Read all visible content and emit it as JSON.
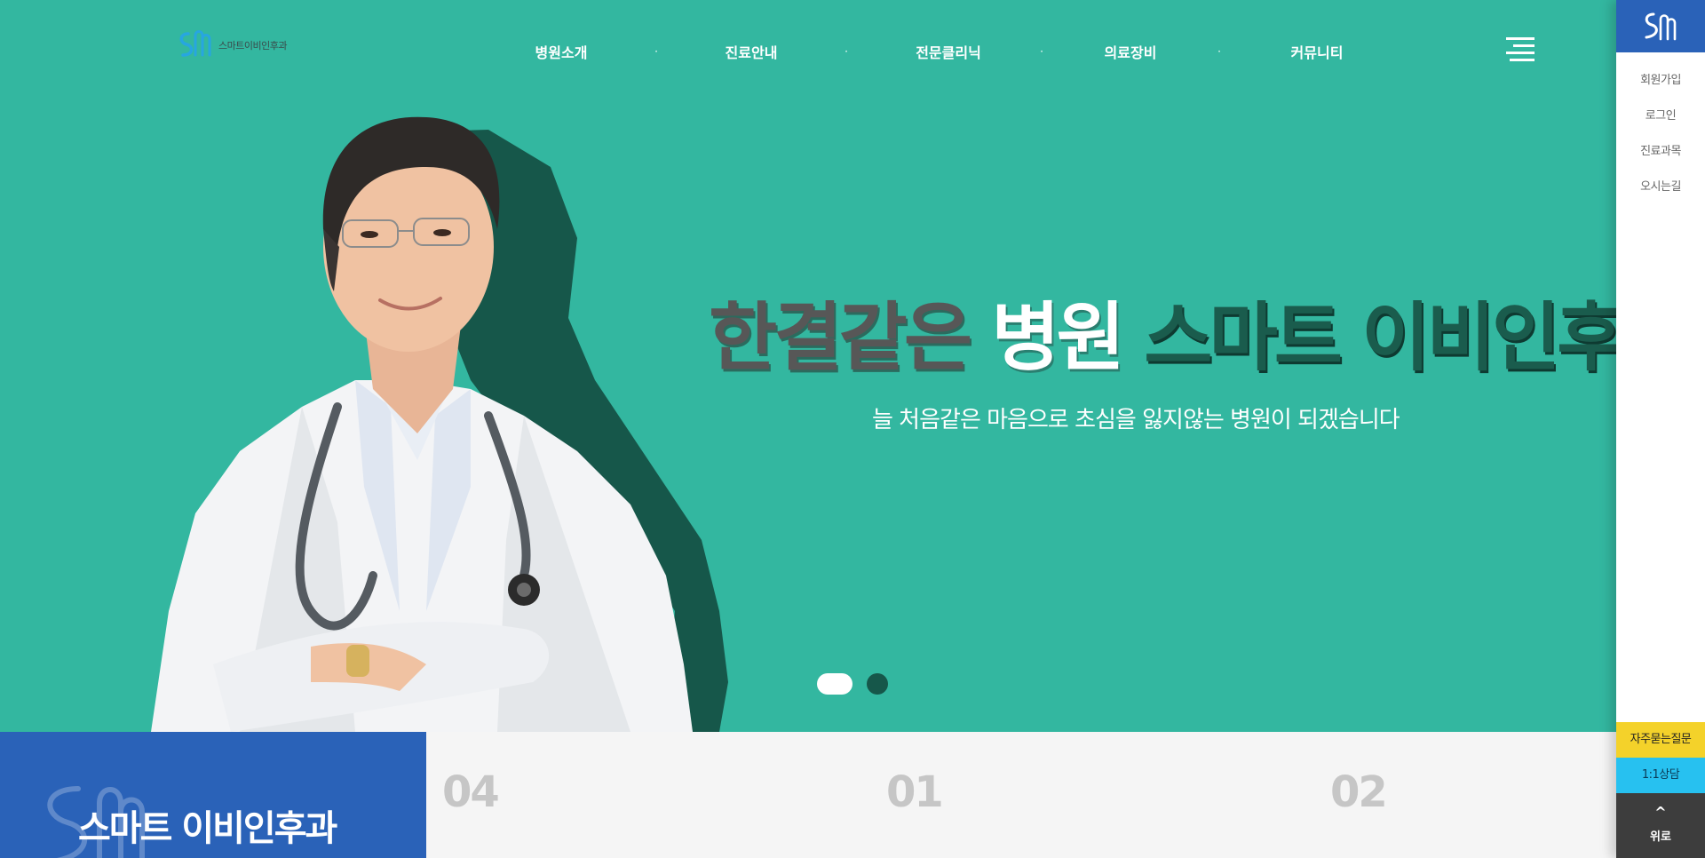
{
  "header": {
    "logo_text": "스마트이비인후과",
    "nav": [
      {
        "label": "병원소개"
      },
      {
        "label": "진료안내"
      },
      {
        "label": "전문클리닉"
      },
      {
        "label": "의료장비"
      },
      {
        "label": "커뮤니티"
      }
    ],
    "nav_separator": "·",
    "menu_icon": "hamburger-menu-icon"
  },
  "hero": {
    "headline_part1": "한결같은",
    "headline_part2": "병원",
    "headline_part3": "스마트 이비인후과",
    "subline": "늘 처음같은 마음으로 초심을 잃지않는 병원이 되겠습니다",
    "slides_total": 2,
    "slide_active": 1,
    "background_color": "#33b7a0",
    "image": "doctor-in-white-coat-with-stethoscope"
  },
  "intro": {
    "brand_title": "스마트 이비인후과",
    "numbers": [
      "04",
      "01",
      "02"
    ],
    "brand_color": "#2a62b8"
  },
  "quickbar": {
    "logo_icon": "sm-logo-icon",
    "links": [
      {
        "label": "회원가입"
      },
      {
        "label": "로그인"
      },
      {
        "label": "진료과목"
      },
      {
        "label": "오시는길"
      }
    ],
    "faq_label": "자주묻는질문",
    "chat_label": "1:1상담",
    "top_arrow": "^",
    "top_label": "위로",
    "faq_color": "#f4d22a",
    "chat_color": "#27c1f0"
  }
}
